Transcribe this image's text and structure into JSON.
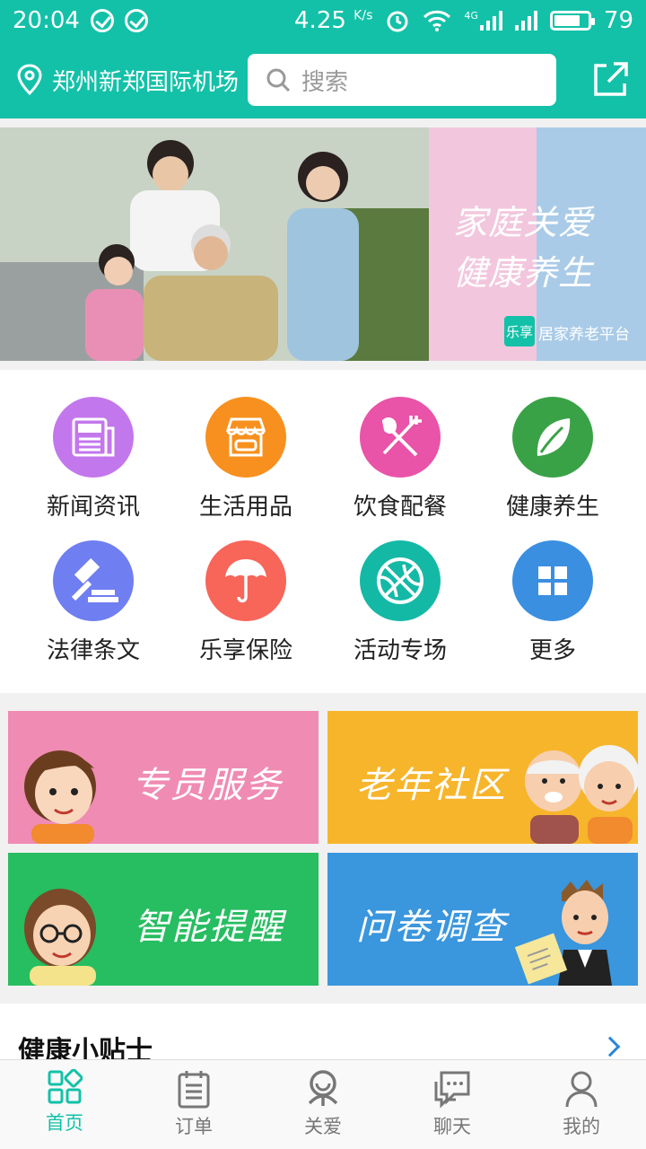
{
  "status_bar": {
    "time": "20:04",
    "net_speed": "4.25",
    "net_unit": "K/s",
    "network": "4G",
    "battery": "79"
  },
  "header": {
    "location": "郑州新郑国际机场",
    "search_placeholder": "搜索"
  },
  "banner": {
    "line1": "家庭关爱",
    "line2": "健康养生",
    "logo_text": "乐享",
    "platform": "居家养老平台"
  },
  "menu": [
    {
      "label": "新闻资讯",
      "icon": "news-icon",
      "color": "#c377ec"
    },
    {
      "label": "生活用品",
      "icon": "store-icon",
      "color": "#f7901e"
    },
    {
      "label": "饮食配餐",
      "icon": "fork-spoon-icon",
      "color": "#e953a8"
    },
    {
      "label": "健康养生",
      "icon": "leaf-icon",
      "color": "#3aa246"
    },
    {
      "label": "法律条文",
      "icon": "gavel-icon",
      "color": "#6f7ef0"
    },
    {
      "label": "乐享保险",
      "icon": "umbrella-icon",
      "color": "#f86559"
    },
    {
      "label": "活动专场",
      "icon": "ball-icon",
      "color": "#14b9a6"
    },
    {
      "label": "更多",
      "icon": "grid-icon",
      "color": "#3a8fe0"
    }
  ],
  "tiles": [
    {
      "label": "专员服务",
      "color": "#f08bb3"
    },
    {
      "label": "老年社区",
      "color": "#f7b52c"
    },
    {
      "label": "智能提醒",
      "color": "#27bd61"
    },
    {
      "label": "问卷调查",
      "color": "#3a96dd"
    }
  ],
  "tips": {
    "title": "健康小贴士"
  },
  "tabs": [
    {
      "label": "首页",
      "icon": "home-icon",
      "active": true
    },
    {
      "label": "订单",
      "icon": "order-icon",
      "active": false
    },
    {
      "label": "关爱",
      "icon": "care-icon",
      "active": false
    },
    {
      "label": "聊天",
      "icon": "chat-icon",
      "active": false
    },
    {
      "label": "我的",
      "icon": "profile-icon",
      "active": false
    }
  ],
  "colors": {
    "primary": "#13c1a8",
    "active_tab": "#13c1a8"
  }
}
